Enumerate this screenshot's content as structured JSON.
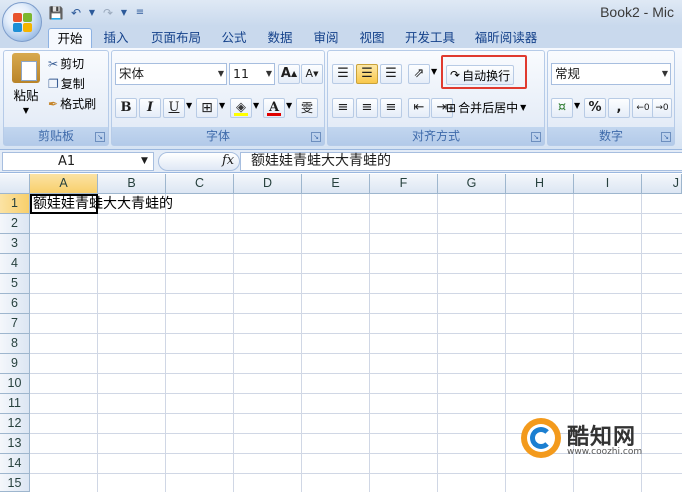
{
  "app": {
    "window_title": "Book2 - Mic"
  },
  "quick_access": {
    "save_icon": "save-icon",
    "undo_icon": "undo-icon",
    "redo_icon": "redo-icon"
  },
  "tabs": [
    {
      "label": "开始",
      "active": true
    },
    {
      "label": "插入"
    },
    {
      "label": "页面布局"
    },
    {
      "label": "公式"
    },
    {
      "label": "数据"
    },
    {
      "label": "审阅"
    },
    {
      "label": "视图"
    },
    {
      "label": "开发工具"
    },
    {
      "label": "福昕阅读器"
    }
  ],
  "ribbon": {
    "clipboard": {
      "label": "剪贴板",
      "paste": "粘贴",
      "cut": "剪切",
      "copy": "复制",
      "format_painter": "格式刷"
    },
    "font": {
      "label": "字体",
      "font_name": "宋体",
      "font_size": "11",
      "bold": "B",
      "italic": "I",
      "underline": "U",
      "font_color_letter": "A",
      "phonetic": "雯"
    },
    "alignment": {
      "label": "对齐方式",
      "wrap_text": "自动换行",
      "merge_center": "合并后居中"
    },
    "number": {
      "label": "数字",
      "format": "常规",
      "percent": "%",
      "comma": ","
    }
  },
  "formula_bar": {
    "name_box": "A1",
    "fx": "fx",
    "content": "额娃娃青蛙大大青蛙的"
  },
  "sheet": {
    "columns": [
      "A",
      "B",
      "C",
      "D",
      "E",
      "F",
      "G",
      "H",
      "I",
      "J"
    ],
    "rows": [
      "1",
      "2",
      "3",
      "4",
      "5",
      "6",
      "7",
      "8",
      "9",
      "10",
      "11",
      "12",
      "13",
      "14",
      "15"
    ],
    "a1_value": "额娃娃青蛙大大青蛙的"
  },
  "watermark": {
    "name": "酷知网",
    "url": "www.coozhi.com"
  },
  "colors": {
    "highlight_box": "#e03a2f",
    "tab_text": "#15428b",
    "ribbon_bg": "#e4edf8"
  }
}
